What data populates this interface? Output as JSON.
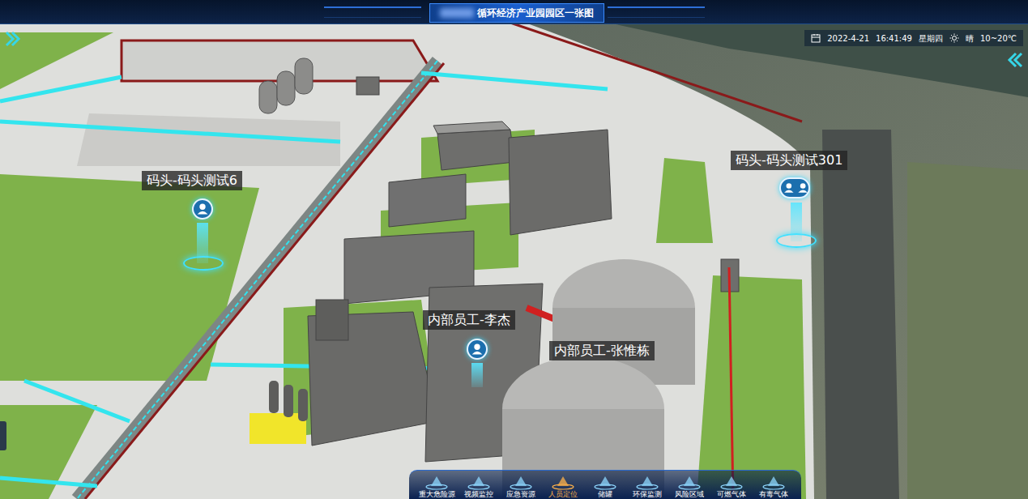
{
  "header": {
    "title": "循环经济产业园园区一张图"
  },
  "datetime": {
    "date": "2022-4-21",
    "time": "16:41:49",
    "weekday": "星期四",
    "weather": "晴",
    "temperature": "10~20℃"
  },
  "pins": [
    {
      "label": "码头-码头测试6",
      "kind": "single"
    },
    {
      "label": "码头-码头测试301",
      "kind": "group"
    },
    {
      "label": "内部员工-李杰",
      "kind": "short"
    },
    {
      "label": "内部员工-张惟栋",
      "kind": "label"
    }
  ],
  "nav": [
    {
      "label": "重大危险源",
      "selected": false
    },
    {
      "label": "视频监控",
      "selected": false
    },
    {
      "label": "应急资源",
      "selected": false
    },
    {
      "label": "人员定位",
      "selected": true
    },
    {
      "label": "储罐",
      "selected": false
    },
    {
      "label": "环保监测",
      "selected": false
    },
    {
      "label": "风险区域",
      "selected": false
    },
    {
      "label": "可燃气体",
      "selected": false
    },
    {
      "label": "有毒气体",
      "selected": false
    }
  ]
}
